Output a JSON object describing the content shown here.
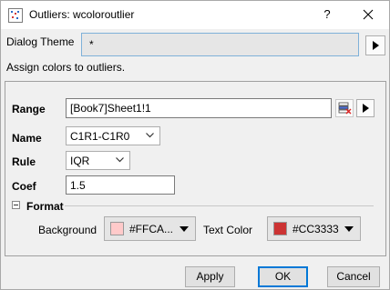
{
  "window": {
    "title": "Outliers: wcoloroutlier",
    "help_label": "?",
    "icons": {
      "app": "origin-app-icon",
      "close": "close-icon"
    }
  },
  "theme": {
    "label": "Dialog Theme",
    "value": "*"
  },
  "description": "Assign colors to outliers.",
  "form": {
    "range": {
      "label": "Range",
      "value": "[Book7]Sheet1!1"
    },
    "name": {
      "label": "Name",
      "value": "C1R1-C1R0"
    },
    "rule": {
      "label": "Rule",
      "value": "IQR"
    },
    "coef": {
      "label": "Coef",
      "value": "1.5"
    }
  },
  "format": {
    "label": "Format",
    "background": {
      "label": "Background",
      "value": "#FFCA...",
      "color": "#FFCACA"
    },
    "text_color": {
      "label": "Text Color",
      "value": "#CC3333",
      "color": "#CC3333"
    }
  },
  "buttons": {
    "apply": "Apply",
    "ok": "OK",
    "cancel": "Cancel"
  },
  "colors": {
    "accent": "#0078d7",
    "input_border": "#7fb1d9"
  }
}
